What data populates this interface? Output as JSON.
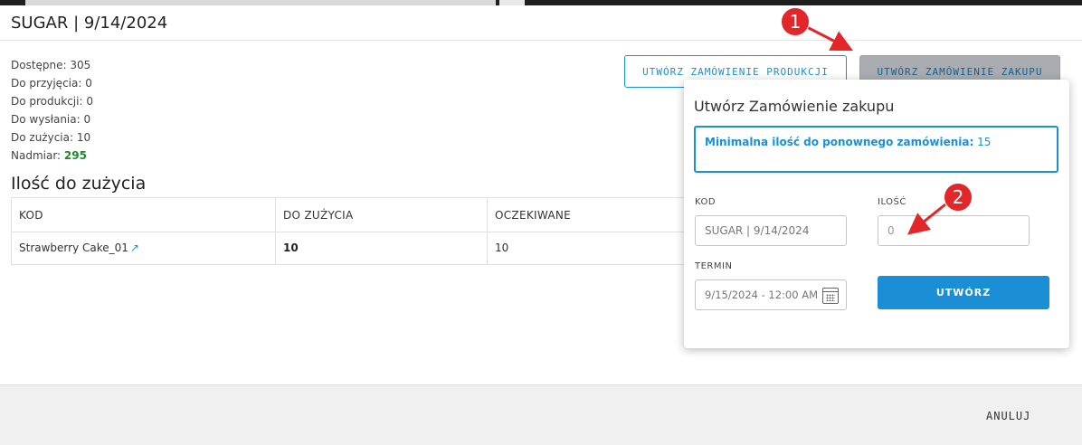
{
  "modal": {
    "title": "SUGAR | 9/14/2024"
  },
  "stats": [
    {
      "label": "Dostępne:",
      "value": "305"
    },
    {
      "label": "Do przyjęcia:",
      "value": "0"
    },
    {
      "label": "Do produkcji:",
      "value": "0"
    },
    {
      "label": "Do wysłania:",
      "value": "0"
    },
    {
      "label": "Do zużycia:",
      "value": "10"
    },
    {
      "label": "Nadmiar:",
      "value": "295"
    }
  ],
  "buttons": {
    "production_order": "UTWÓRZ ZAMÓWIENIE PRODUKCJI",
    "purchase_order": "UTWÓRZ ZAMÓWIENIE ZAKUPU"
  },
  "section": {
    "title": "Ilość do zużycia"
  },
  "table": {
    "headers": [
      "KOD",
      "DO ZUŻYCIA",
      "OCZEKIWANE"
    ],
    "rows": [
      {
        "kod": "Strawberry Cake_01",
        "do_zuzycia": "10",
        "oczekiwane": "10"
      }
    ]
  },
  "popover": {
    "title": "Utwórz Zamówienie zakupu",
    "info_label": "Minimalna ilość do ponownego zamówienia:",
    "info_value": "15",
    "kod_label": "KOD",
    "kod_value": "SUGAR | 9/14/2024",
    "ilosc_label": "ILOŚĆ",
    "ilosc_placeholder": "0",
    "termin_label": "TERMIN",
    "termin_value": "9/15/2024 - 12:00 AM",
    "create_label": "UTWÓRZ"
  },
  "footer": {
    "cancel_label": "ANULUJ"
  },
  "annotations": [
    {
      "number": "1"
    },
    {
      "number": "2"
    }
  ],
  "colors": {
    "accent": "#1a8fd6",
    "excess": "#1a8a2a",
    "annotation": "#e3262a"
  }
}
